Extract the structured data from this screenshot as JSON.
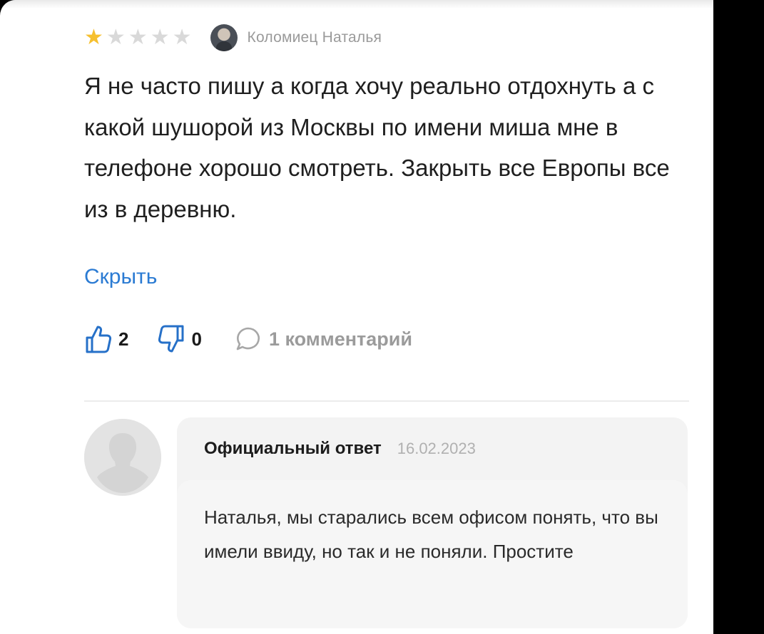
{
  "review": {
    "rating": 1,
    "max_rating": 5,
    "author_name": "Коломиец Наталья",
    "text": "Я не часто пишу а когда хочу реально отдохнуть а с какой шушорой из Москвы по имени миша мне в телефоне хорошо смотреть.  Закрыть все Европы все из в деревню.",
    "hide_label": "Скрыть",
    "likes": "2",
    "dislikes": "0",
    "comments_label": "1 комментарий"
  },
  "official_reply": {
    "title": "Официальный ответ",
    "date": "16.02.2023",
    "text": "Наталья, мы старались всем офисом понять, что вы имели ввиду, но так и не поняли. Простите"
  },
  "colors": {
    "star_filled": "#f6c02f",
    "star_empty": "#d9d9d9",
    "link": "#2b7bd3"
  },
  "icons": [
    "star-icon",
    "like-icon",
    "dislike-icon",
    "comment-icon",
    "user-placeholder-icon"
  ]
}
